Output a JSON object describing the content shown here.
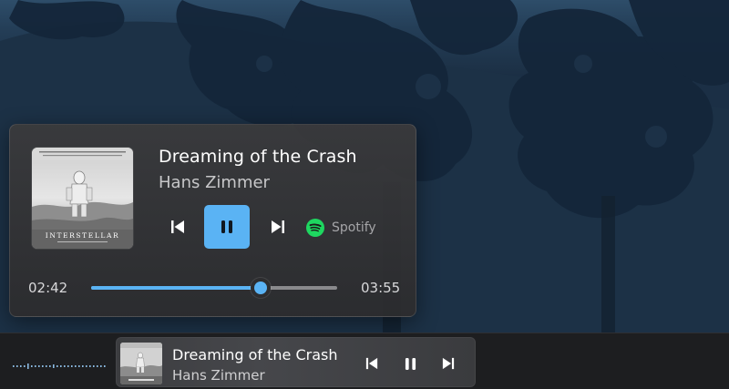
{
  "media_flyout": {
    "title": "Dreaming of the Crash",
    "artist": "Hans Zimmer",
    "source": "Spotify",
    "elapsed": "02:42",
    "duration": "03:55",
    "progress": 0.6894,
    "album_art_text": "INTERSTELLAR",
    "controls": {
      "previous": "previous-track-icon",
      "play_pause": "pause-icon",
      "next": "next-track-icon"
    },
    "accent_color": "#5ab3f4",
    "source_color": "#1ed760"
  },
  "taskbar": {
    "mini_player": {
      "title": "Dreaming of the Crash",
      "artist": "Hans Zimmer",
      "controls": {
        "previous": "previous-track-icon",
        "play_pause": "pause-icon",
        "next": "next-track-icon"
      }
    }
  }
}
